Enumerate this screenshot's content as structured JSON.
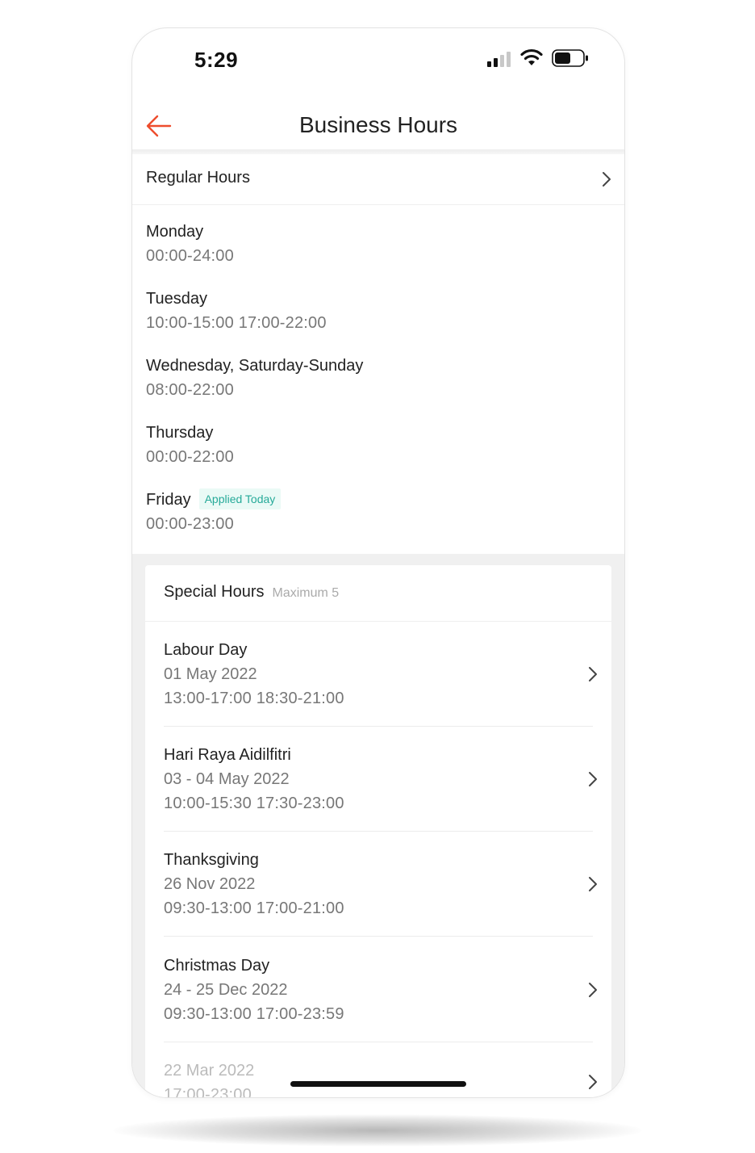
{
  "status_bar": {
    "time": "5:29",
    "icons": [
      "cellular-signal-icon",
      "wifi-icon",
      "battery-icon"
    ]
  },
  "nav": {
    "title": "Business Hours",
    "back_icon": "arrow-left-icon",
    "accent_color": "#ee4d2d"
  },
  "regular_hours": {
    "title": "Regular Hours",
    "days": [
      {
        "name": "Monday",
        "hours": "00:00-24:00"
      },
      {
        "name": "Tuesday",
        "hours": "10:00-15:00 17:00-22:00"
      },
      {
        "name": "Wednesday, Saturday-Sunday",
        "hours": "08:00-22:00"
      },
      {
        "name": "Thursday",
        "hours": "00:00-22:00"
      },
      {
        "name": "Friday",
        "hours": "00:00-23:00",
        "badge": "Applied Today"
      }
    ]
  },
  "special_hours": {
    "title": "Special Hours",
    "subtitle": "Maximum 5",
    "items": [
      {
        "name": "Labour Day",
        "date": "01 May 2022",
        "hours": "13:00-17:00 18:30-21:00"
      },
      {
        "name": "Hari Raya Aidilfitri",
        "date": "03 - 04 May 2022",
        "hours": "10:00-15:30 17:30-23:00"
      },
      {
        "name": "Thanksgiving",
        "date": "26 Nov 2022",
        "hours": "09:30-13:00 17:00-21:00"
      },
      {
        "name": "Christmas Day",
        "date": "24 - 25 Dec 2022",
        "hours": "09:30-13:00 17:00-23:59"
      },
      {
        "name": "",
        "date": "22 Mar 2022",
        "hours": "17:00-23:00"
      }
    ]
  },
  "colors": {
    "badge_text": "#26aa99",
    "badge_bg": "#eafaf6"
  }
}
